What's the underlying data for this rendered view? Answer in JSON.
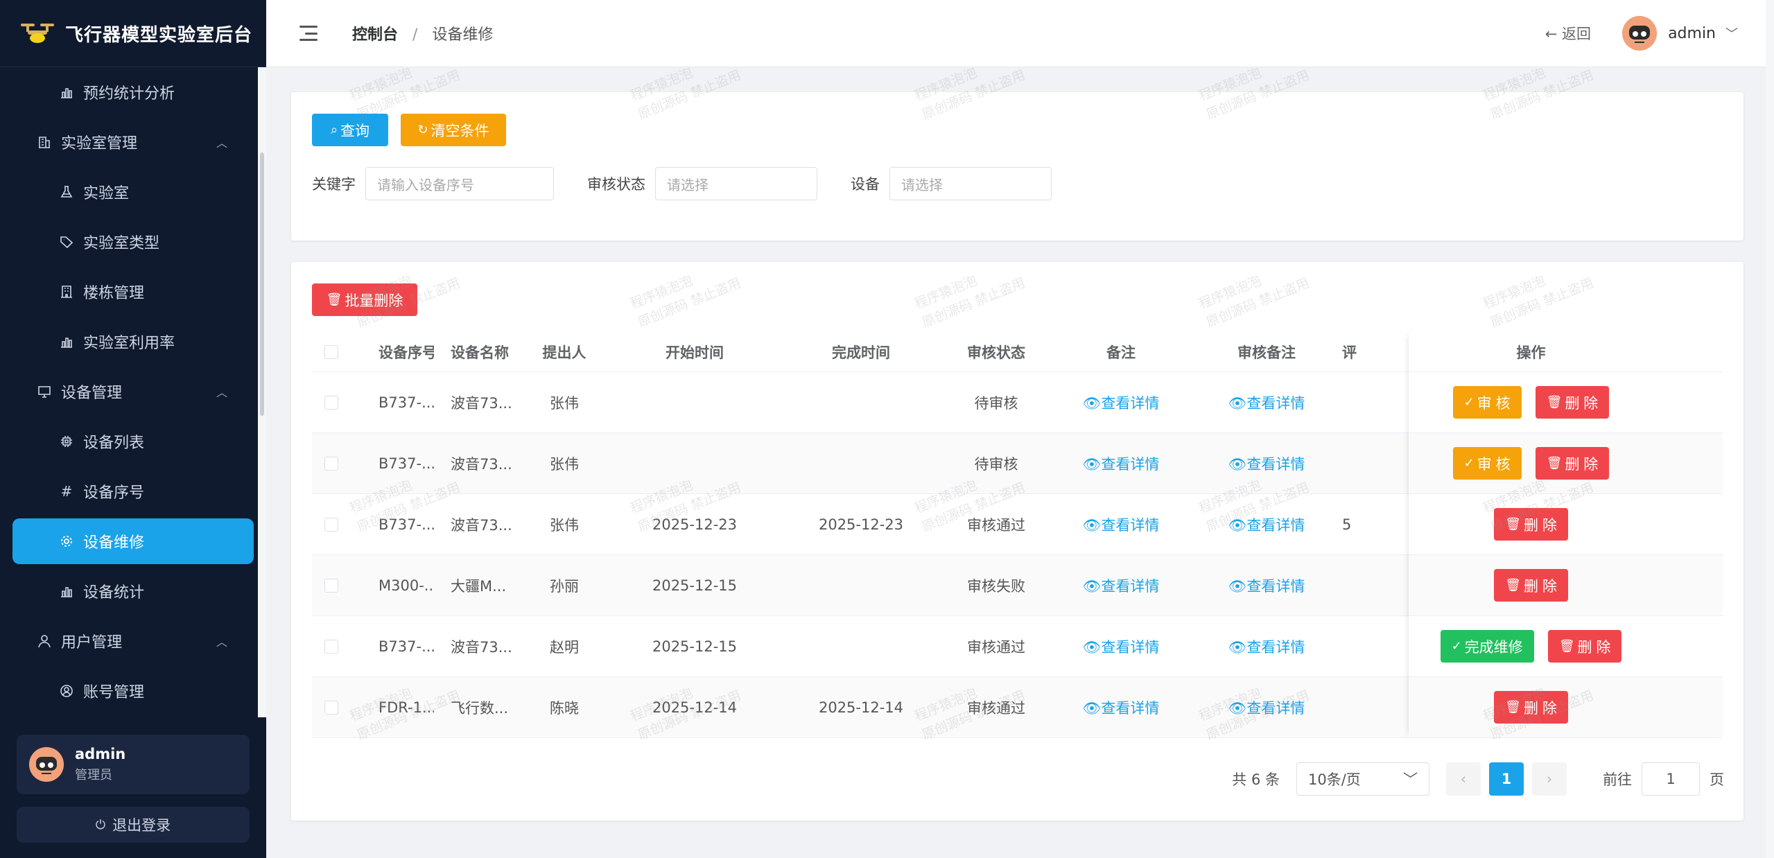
{
  "sidebar": {
    "brand_title": "飞行器模型实验室后台",
    "items": [
      {
        "label": "预约统计分析",
        "icon": "bar-chart-icon",
        "type": "sub"
      },
      {
        "label": "实验室管理",
        "icon": "building-icon",
        "type": "group"
      },
      {
        "label": "实验室",
        "icon": "flask-icon",
        "type": "sub"
      },
      {
        "label": "实验室类型",
        "icon": "tag-icon",
        "type": "sub"
      },
      {
        "label": "楼栋管理",
        "icon": "office-building-icon",
        "type": "sub"
      },
      {
        "label": "实验室利用率",
        "icon": "bar-chart-icon",
        "type": "sub"
      },
      {
        "label": "设备管理",
        "icon": "monitor-icon",
        "type": "group"
      },
      {
        "label": "设备列表",
        "icon": "chip-icon",
        "type": "sub"
      },
      {
        "label": "设备序号",
        "icon": "hash-icon",
        "type": "sub"
      },
      {
        "label": "设备维修",
        "icon": "gear-icon",
        "type": "active"
      },
      {
        "label": "设备统计",
        "icon": "bar-chart-icon",
        "type": "sub"
      },
      {
        "label": "用户管理",
        "icon": "user-icon",
        "type": "group"
      },
      {
        "label": "账号管理",
        "icon": "account-icon",
        "type": "sub"
      }
    ],
    "user": {
      "name": "admin",
      "role": "管理员"
    },
    "logout_label": "退出登录"
  },
  "header": {
    "breadcrumb_home": "控制台",
    "breadcrumb_sep": "/",
    "breadcrumb_current": "设备维修",
    "back_label": "返回",
    "username": "admin"
  },
  "search": {
    "query_label": "查询",
    "clear_label": "清空条件",
    "keyword_label": "关键字",
    "keyword_placeholder": "请输入设备序号",
    "status_label": "审核状态",
    "status_placeholder": "请选择",
    "device_label": "设备",
    "device_placeholder": "请选择"
  },
  "table": {
    "batch_delete_label": "批量删除",
    "headers": [
      "设备序号",
      "设备名称",
      "提出人",
      "开始时间",
      "完成时间",
      "审核状态",
      "备注",
      "审核备注",
      "评",
      "操作"
    ],
    "view_detail": "查看详情",
    "rows": [
      {
        "sn": "B737-...",
        "name": "波音73...",
        "user": "张伟",
        "start": "",
        "end": "",
        "status": "待审核",
        "eval": "",
        "ops": [
          "审 核",
          "删 除"
        ]
      },
      {
        "sn": "B737-...",
        "name": "波音73...",
        "user": "张伟",
        "start": "",
        "end": "",
        "status": "待审核",
        "eval": "",
        "ops": [
          "审 核",
          "删 除"
        ]
      },
      {
        "sn": "B737-...",
        "name": "波音73...",
        "user": "张伟",
        "start": "2025-12-23",
        "end": "2025-12-23",
        "status": "审核通过",
        "eval": "5",
        "ops": [
          "删 除"
        ]
      },
      {
        "sn": "M300-...",
        "name": "大疆M...",
        "user": "孙丽",
        "start": "2025-12-15",
        "end": "",
        "status": "审核失败",
        "eval": "",
        "ops": [
          "删 除"
        ]
      },
      {
        "sn": "B737-...",
        "name": "波音73...",
        "user": "赵明",
        "start": "2025-12-15",
        "end": "",
        "status": "审核通过",
        "eval": "",
        "ops": [
          "完成维修",
          "删 除"
        ]
      },
      {
        "sn": "FDR-1...",
        "name": "飞行数...",
        "user": "陈晓",
        "start": "2025-12-14",
        "end": "2025-12-14",
        "status": "审核通过",
        "eval": "",
        "ops": [
          "删 除"
        ]
      }
    ]
  },
  "pagination": {
    "total": "共 6 条",
    "page_size": "10条/页",
    "current_page": "1",
    "goto_label": "前往",
    "goto_value": "1",
    "page_suffix": "页"
  },
  "watermark": {
    "line1": "程序猿泡泡",
    "line2": "原创源码 禁止盗用"
  },
  "colors": {
    "sidebar_bg": "#0f1a2e",
    "accent": "#1aa3e8",
    "orange": "#f5a20b",
    "danger": "#f0464b",
    "success": "#22c05e"
  }
}
